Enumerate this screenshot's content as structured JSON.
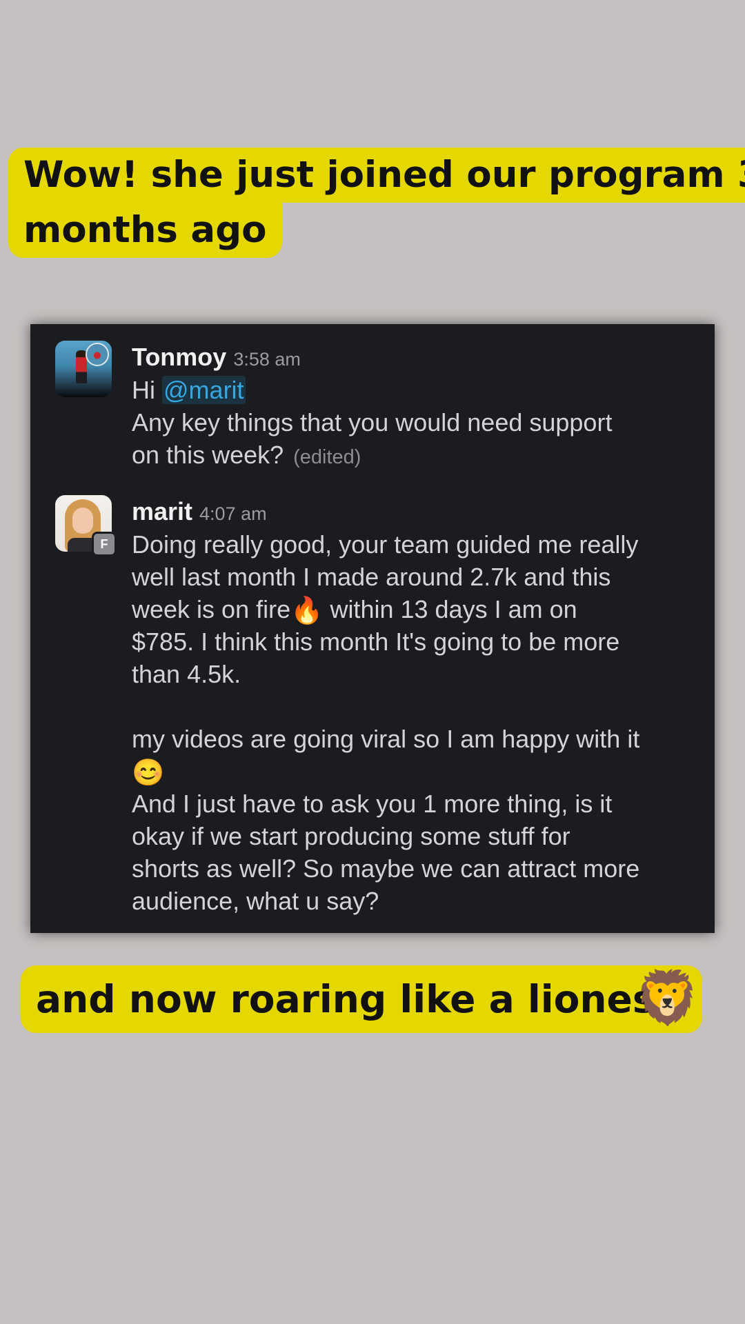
{
  "captions": {
    "top_line1": "Wow! she just joined our program 3",
    "top_line2": "months ago",
    "bottom": "and now roaring like a lioness",
    "bottom_emoji": "🦁"
  },
  "messages": [
    {
      "author": "Tonmoy",
      "time": "3:58 am",
      "greeting": "Hi",
      "mention": "@marit",
      "line2": "Any key things that you would need support",
      "line3": "on this week?",
      "edited_label": "(edited)"
    },
    {
      "author": "marit",
      "time": "4:07 am",
      "badge": "F",
      "p1_line1": "Doing really good, your team guided me really",
      "p1_line2": "well last month I made around 2.7k and this",
      "p1_line3a": "week is on fire",
      "fire_emoji": "🔥",
      "p1_line3b": " within 13 days I am on",
      "p1_line4": "$785. I think this month It's going to be more",
      "p1_line5": "than 4.5k.",
      "p2_line1": "my videos are going viral so I am happy with it",
      "smile_emoji": "😊",
      "p3_line1": "And I just have to ask you 1 more thing, is it",
      "p3_line2": "okay if we start producing some stuff for",
      "p3_line3": "shorts as well? So maybe we can attract more",
      "p3_line4": "audience, what u say?"
    }
  ],
  "colors": {
    "background": "#c5c1c0",
    "highlight": "#e5d700",
    "chat_background": "#1b1c20",
    "mention": "#36a7e0"
  }
}
